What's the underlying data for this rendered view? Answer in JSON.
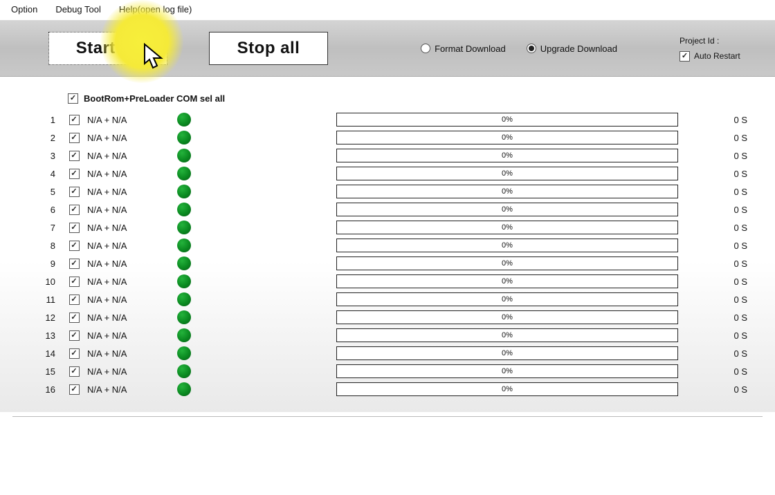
{
  "menu": {
    "option": "Option",
    "debug": "Debug Tool",
    "help": "Help(open log file)"
  },
  "toolbar": {
    "start": "Start all",
    "stop": "Stop all",
    "format": "Format Download",
    "upgrade": "Upgrade Download",
    "project": "Project Id :",
    "auto": "Auto Restart"
  },
  "header": {
    "sel_all": "BootRom+PreLoader COM sel all"
  },
  "rows": [
    {
      "idx": "1",
      "val": "N/A + N/A",
      "pct": "0%",
      "time": "0 S"
    },
    {
      "idx": "2",
      "val": "N/A + N/A",
      "pct": "0%",
      "time": "0 S"
    },
    {
      "idx": "3",
      "val": "N/A + N/A",
      "pct": "0%",
      "time": "0 S"
    },
    {
      "idx": "4",
      "val": "N/A + N/A",
      "pct": "0%",
      "time": "0 S"
    },
    {
      "idx": "5",
      "val": "N/A + N/A",
      "pct": "0%",
      "time": "0 S"
    },
    {
      "idx": "6",
      "val": "N/A + N/A",
      "pct": "0%",
      "time": "0 S"
    },
    {
      "idx": "7",
      "val": "N/A + N/A",
      "pct": "0%",
      "time": "0 S"
    },
    {
      "idx": "8",
      "val": "N/A + N/A",
      "pct": "0%",
      "time": "0 S"
    },
    {
      "idx": "9",
      "val": "N/A + N/A",
      "pct": "0%",
      "time": "0 S"
    },
    {
      "idx": "10",
      "val": "N/A + N/A",
      "pct": "0%",
      "time": "0 S"
    },
    {
      "idx": "11",
      "val": "N/A + N/A",
      "pct": "0%",
      "time": "0 S"
    },
    {
      "idx": "12",
      "val": "N/A + N/A",
      "pct": "0%",
      "time": "0 S"
    },
    {
      "idx": "13",
      "val": "N/A + N/A",
      "pct": "0%",
      "time": "0 S"
    },
    {
      "idx": "14",
      "val": "N/A + N/A",
      "pct": "0%",
      "time": "0 S"
    },
    {
      "idx": "15",
      "val": "N/A + N/A",
      "pct": "0%",
      "time": "0 S"
    },
    {
      "idx": "16",
      "val": "N/A + N/A",
      "pct": "0%",
      "time": "0 S"
    }
  ]
}
